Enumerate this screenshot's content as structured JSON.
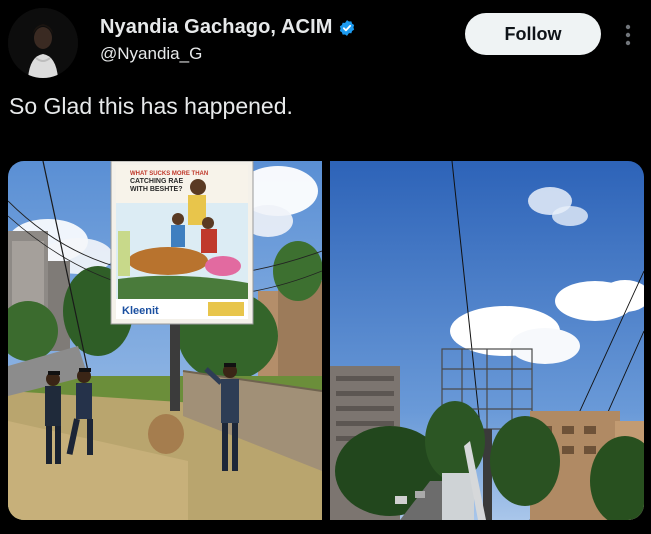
{
  "author": {
    "display_name": "Nyandia Gachago, ACIM",
    "handle": "@Nyandia_G",
    "verified": true,
    "avatar_icon": "person-avatar"
  },
  "actions": {
    "follow_label": "Follow",
    "more_icon": "more-vertical-icon"
  },
  "tweet": {
    "text": "So Glad this has happened."
  },
  "media": {
    "photo_count": 2,
    "left_photo": {
      "billboard_headline": "WHAT SUCKS MORE THAN CATCHING RAE WITH BESHTE?",
      "billboard_brand": "Kleenit"
    }
  },
  "colors": {
    "background": "#000000",
    "text": "#e7e9ea",
    "follow_bg": "#eff3f4",
    "verified": "#1d9bf0"
  }
}
